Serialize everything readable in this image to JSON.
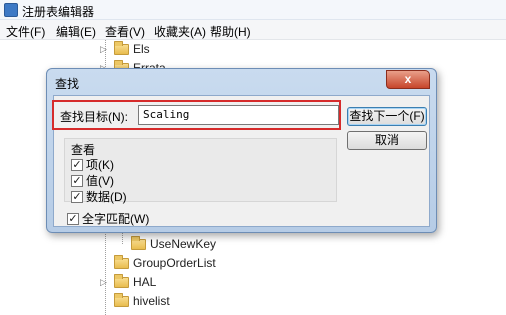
{
  "window": {
    "title": "注册表编辑器"
  },
  "menu": [
    "文件(F)",
    "编辑(E)",
    "查看(V)",
    "收藏夹(A)",
    "帮助(H)"
  ],
  "tree": {
    "top_items": [
      "Els",
      "Errata"
    ],
    "bottom_items": [
      "UseNewKey",
      "GroupOrderList",
      "HAL",
      "hivelist"
    ]
  },
  "dialog": {
    "title": "查找",
    "close_glyph": "x",
    "find_label": "查找目标(N):",
    "find_value": "Scaling",
    "find_next": "查找下一个(F)",
    "cancel": "取消",
    "lookat_title": "查看",
    "options": [
      {
        "label": "项(K)",
        "checked": true
      },
      {
        "label": "值(V)",
        "checked": true
      },
      {
        "label": "数据(D)",
        "checked": true
      }
    ],
    "whole_match": {
      "label": "全字匹配(W)",
      "checked": true
    },
    "check_glyph": "✓"
  }
}
